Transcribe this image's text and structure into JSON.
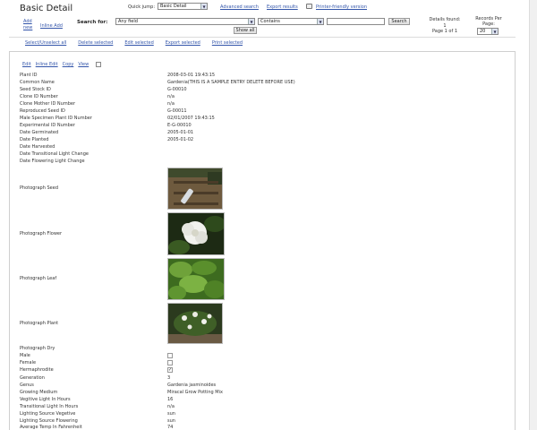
{
  "page": {
    "title": "Basic Detail"
  },
  "header": {
    "quick_jump_label": "Quick jump:",
    "quick_jump_value": "Basic Detail",
    "advanced_search": "Advanced search",
    "export_results": "Export results",
    "printer_friendly": "Printer-friendly version"
  },
  "search": {
    "add_new": "Add new",
    "inline_add": "Inline Add",
    "label": "Search for:",
    "field_value": "Any field",
    "operator_value": "Contains",
    "search_button": "Search",
    "show_all_button": "Show all",
    "details_found_label": "Details found:",
    "details_found_count": "1",
    "page_info": "Page 1 of 1",
    "records_per_page_label": "Records Per Page:",
    "records_per_page_value": "20"
  },
  "actions": {
    "select_all": "Select/Unselect all",
    "delete_selected": "Delete selected",
    "edit_selected": "Edit selected",
    "export_selected": "Export selected",
    "print_selected": "Print selected"
  },
  "record_toolbar": {
    "edit": "Edit",
    "inline_edit": "Inline Edit",
    "copy": "Copy",
    "view": "View"
  },
  "fields": [
    {
      "label": "Plant ID",
      "value": "2008-03-01 19:43:15"
    },
    {
      "label": "Common Name",
      "value": "Gardenia(THIS IS A SAMPLE ENTRY DELETE BEFORE USE)"
    },
    {
      "label": "Seed Stock ID",
      "value": "G-00010"
    },
    {
      "label": "Clone ID Number",
      "value": "n/a"
    },
    {
      "label": "Clone Mother ID Number",
      "value": "n/a"
    },
    {
      "label": "Reproduced Seed ID",
      "value": "G-00011"
    },
    {
      "label": "Male Specimen Plant ID Number",
      "value": "02/01/2007 19:43:15"
    },
    {
      "label": "Experimental ID Number",
      "value": "E-G-00010"
    },
    {
      "label": "Date Germinated",
      "value": "2005-01-01"
    },
    {
      "label": "Date Planted",
      "value": "2005-01-02"
    },
    {
      "label": "Date Harvested",
      "value": ""
    },
    {
      "label": "Date Transitional Light Change",
      "value": ""
    },
    {
      "label": "Date Flowering Light Change",
      "value": ""
    }
  ],
  "photos": [
    {
      "label": "Photograph Seed",
      "icon": "seed-photo"
    },
    {
      "label": "Photograph Flower",
      "icon": "flower-photo"
    },
    {
      "label": "Photograph Leaf",
      "icon": "leaf-photo"
    },
    {
      "label": "Photograph Plant",
      "icon": "plant-photo"
    }
  ],
  "photo_dry_label": "Photograph Dry",
  "checkbox_fields": [
    {
      "label": "Male",
      "checked": ""
    },
    {
      "label": "Female",
      "checked": ""
    },
    {
      "label": "Hermaphrodite",
      "checked": "✓"
    }
  ],
  "more_fields": [
    {
      "label": "Generation",
      "value": "3"
    },
    {
      "label": "Genus",
      "value": "Gardenia jasminoides"
    },
    {
      "label": "Growing Medium",
      "value": "Miracal Grow Potting Mix"
    },
    {
      "label": "Vegitive Light In Hours",
      "value": "16"
    },
    {
      "label": "Transitional Light In Hours",
      "value": "n/a"
    },
    {
      "label": "Lighting Source Vegetive",
      "value": "sun"
    },
    {
      "label": "Lighting Source Flowering",
      "value": "sun"
    },
    {
      "label": "Average Temp In Fahrenheit",
      "value": "74"
    }
  ]
}
